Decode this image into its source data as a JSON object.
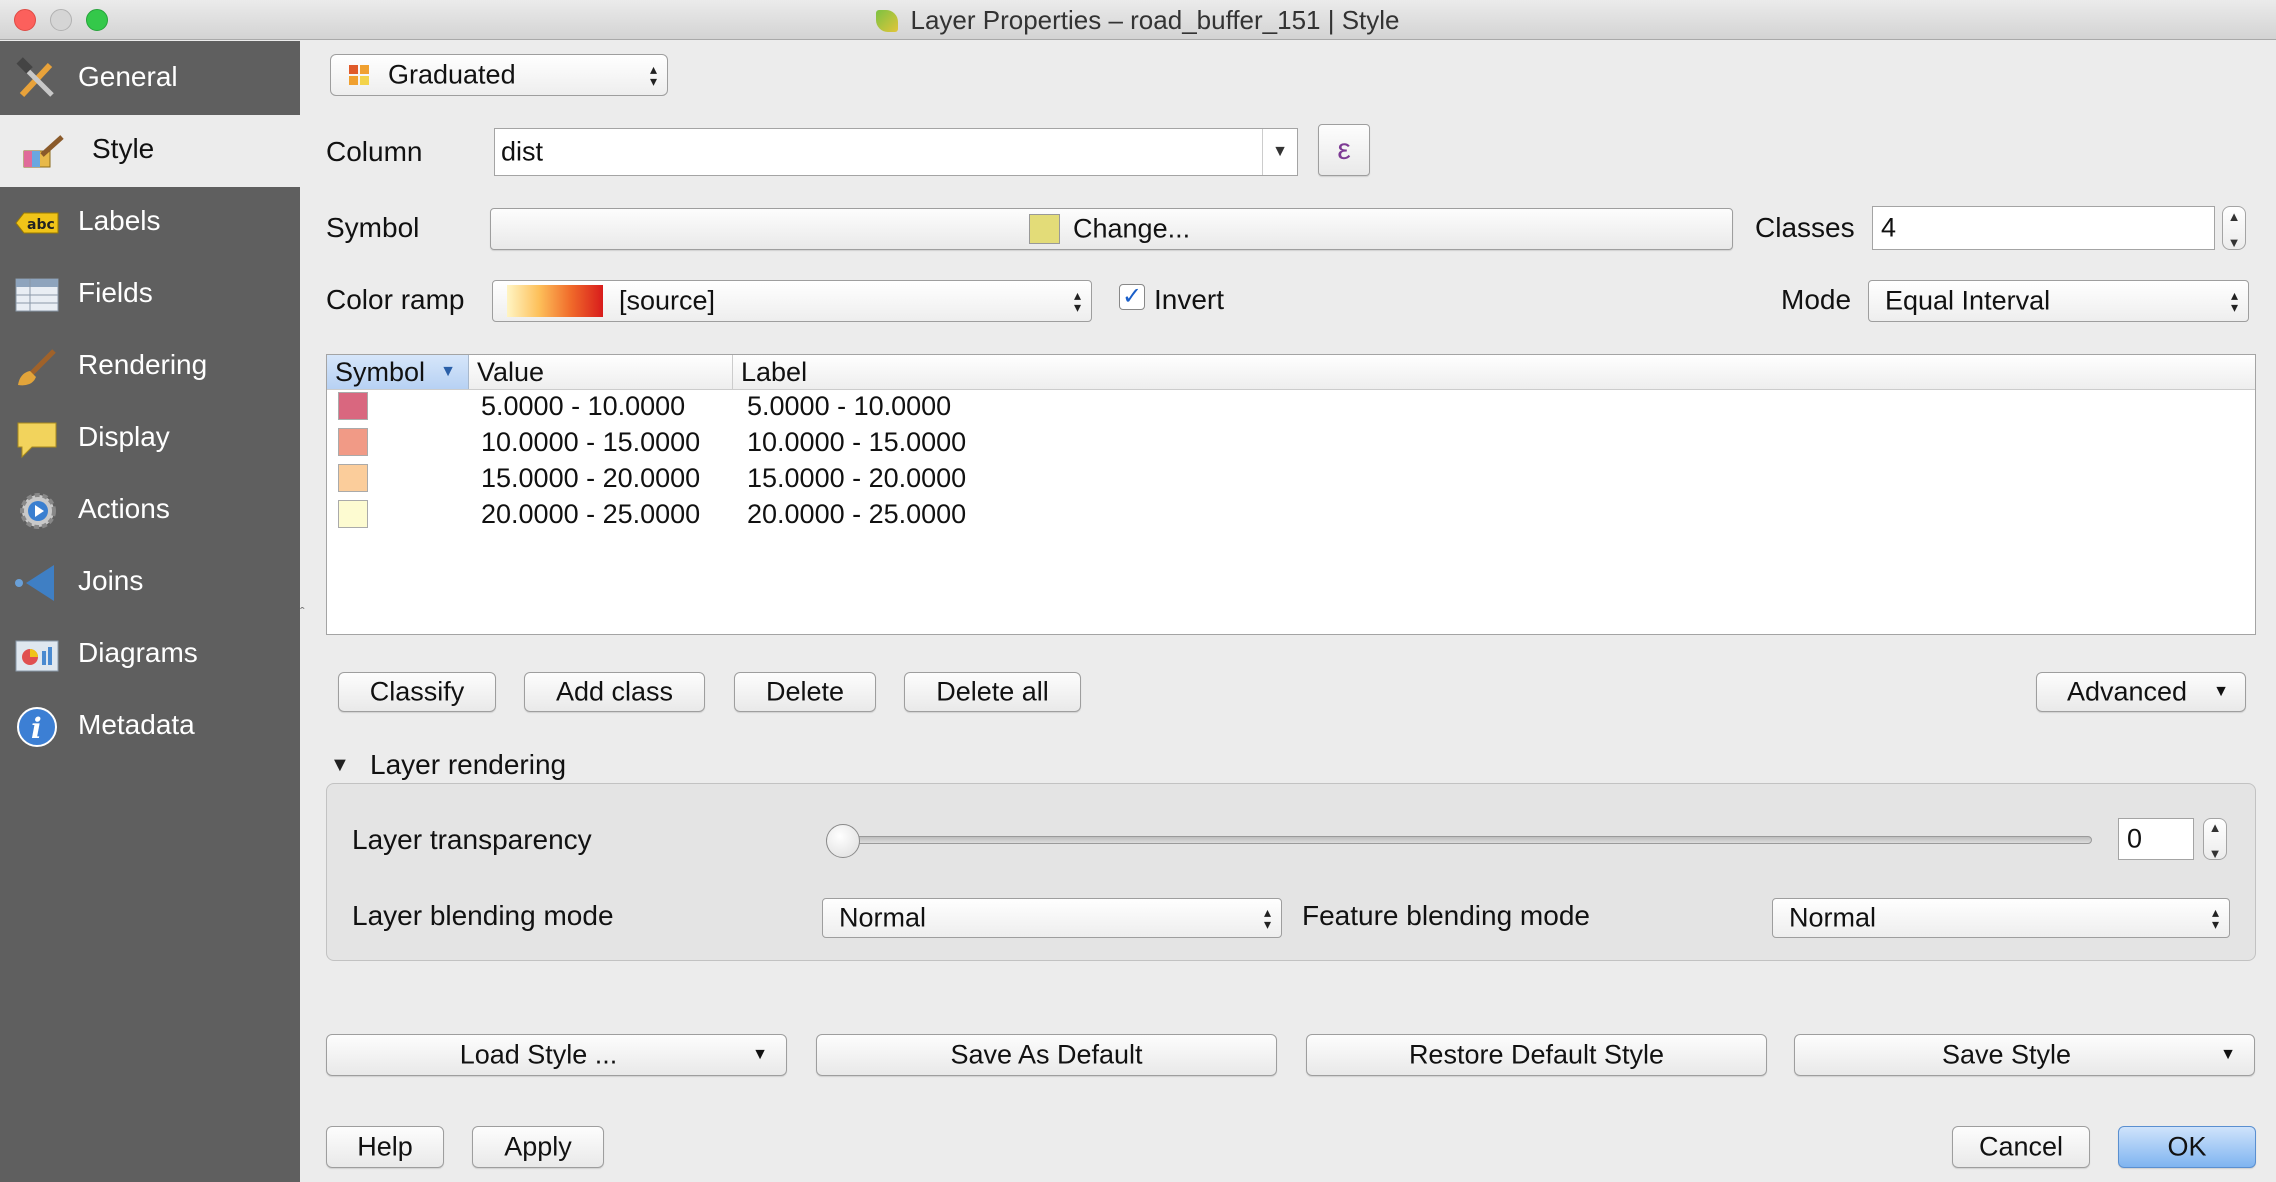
{
  "window": {
    "title": "Layer Properties – road_buffer_151 | Style"
  },
  "sidebar": {
    "items": [
      {
        "label": "General",
        "icon": "tools-icon"
      },
      {
        "label": "Style",
        "icon": "paintbrush-icon"
      },
      {
        "label": "Labels",
        "icon": "abc-label-icon"
      },
      {
        "label": "Fields",
        "icon": "table-icon"
      },
      {
        "label": "Rendering",
        "icon": "brush-icon"
      },
      {
        "label": "Display",
        "icon": "speech-bubble-icon"
      },
      {
        "label": "Actions",
        "icon": "gear-play-icon"
      },
      {
        "label": "Joins",
        "icon": "join-arrow-icon"
      },
      {
        "label": "Diagrams",
        "icon": "diagram-icon"
      },
      {
        "label": "Metadata",
        "icon": "info-icon"
      }
    ],
    "active": "Style"
  },
  "renderer": {
    "type_label": "Graduated"
  },
  "column": {
    "label": "Column",
    "value": "dist",
    "expression_button": "ε"
  },
  "symbol": {
    "label": "Symbol",
    "change_button": "Change...",
    "color": "#e3dc78"
  },
  "classes": {
    "label": "Classes",
    "value": "4"
  },
  "color_ramp": {
    "label": "Color ramp",
    "value": "[source]",
    "invert_label": "Invert",
    "invert_checked": true
  },
  "mode": {
    "label": "Mode",
    "value": "Equal Interval"
  },
  "table": {
    "headers": {
      "symbol": "Symbol",
      "value": "Value",
      "label": "Label"
    },
    "rows": [
      {
        "color": "#d9677f",
        "value": "5.0000 - 10.0000",
        "label": "5.0000 - 10.0000"
      },
      {
        "color": "#f19a86",
        "value": "10.0000 - 15.0000",
        "label": "10.0000 - 15.0000"
      },
      {
        "color": "#fbcd9b",
        "value": "15.0000 - 20.0000",
        "label": "15.0000 - 20.0000"
      },
      {
        "color": "#fdfbd1",
        "value": "20.0000 - 25.0000",
        "label": "20.0000 - 25.0000"
      }
    ]
  },
  "table_buttons": {
    "classify": "Classify",
    "add_class": "Add class",
    "delete": "Delete",
    "delete_all": "Delete all",
    "advanced": "Advanced"
  },
  "layer_rendering": {
    "title": "Layer rendering",
    "transparency_label": "Layer transparency",
    "transparency_value": "0",
    "layer_blend_label": "Layer blending mode",
    "layer_blend_value": "Normal",
    "feature_blend_label": "Feature blending mode",
    "feature_blend_value": "Normal"
  },
  "style_buttons": {
    "load": "Load Style ...",
    "save_default": "Save As Default",
    "restore": "Restore Default Style",
    "save": "Save Style"
  },
  "dialog_buttons": {
    "help": "Help",
    "apply": "Apply",
    "cancel": "Cancel",
    "ok": "OK"
  }
}
